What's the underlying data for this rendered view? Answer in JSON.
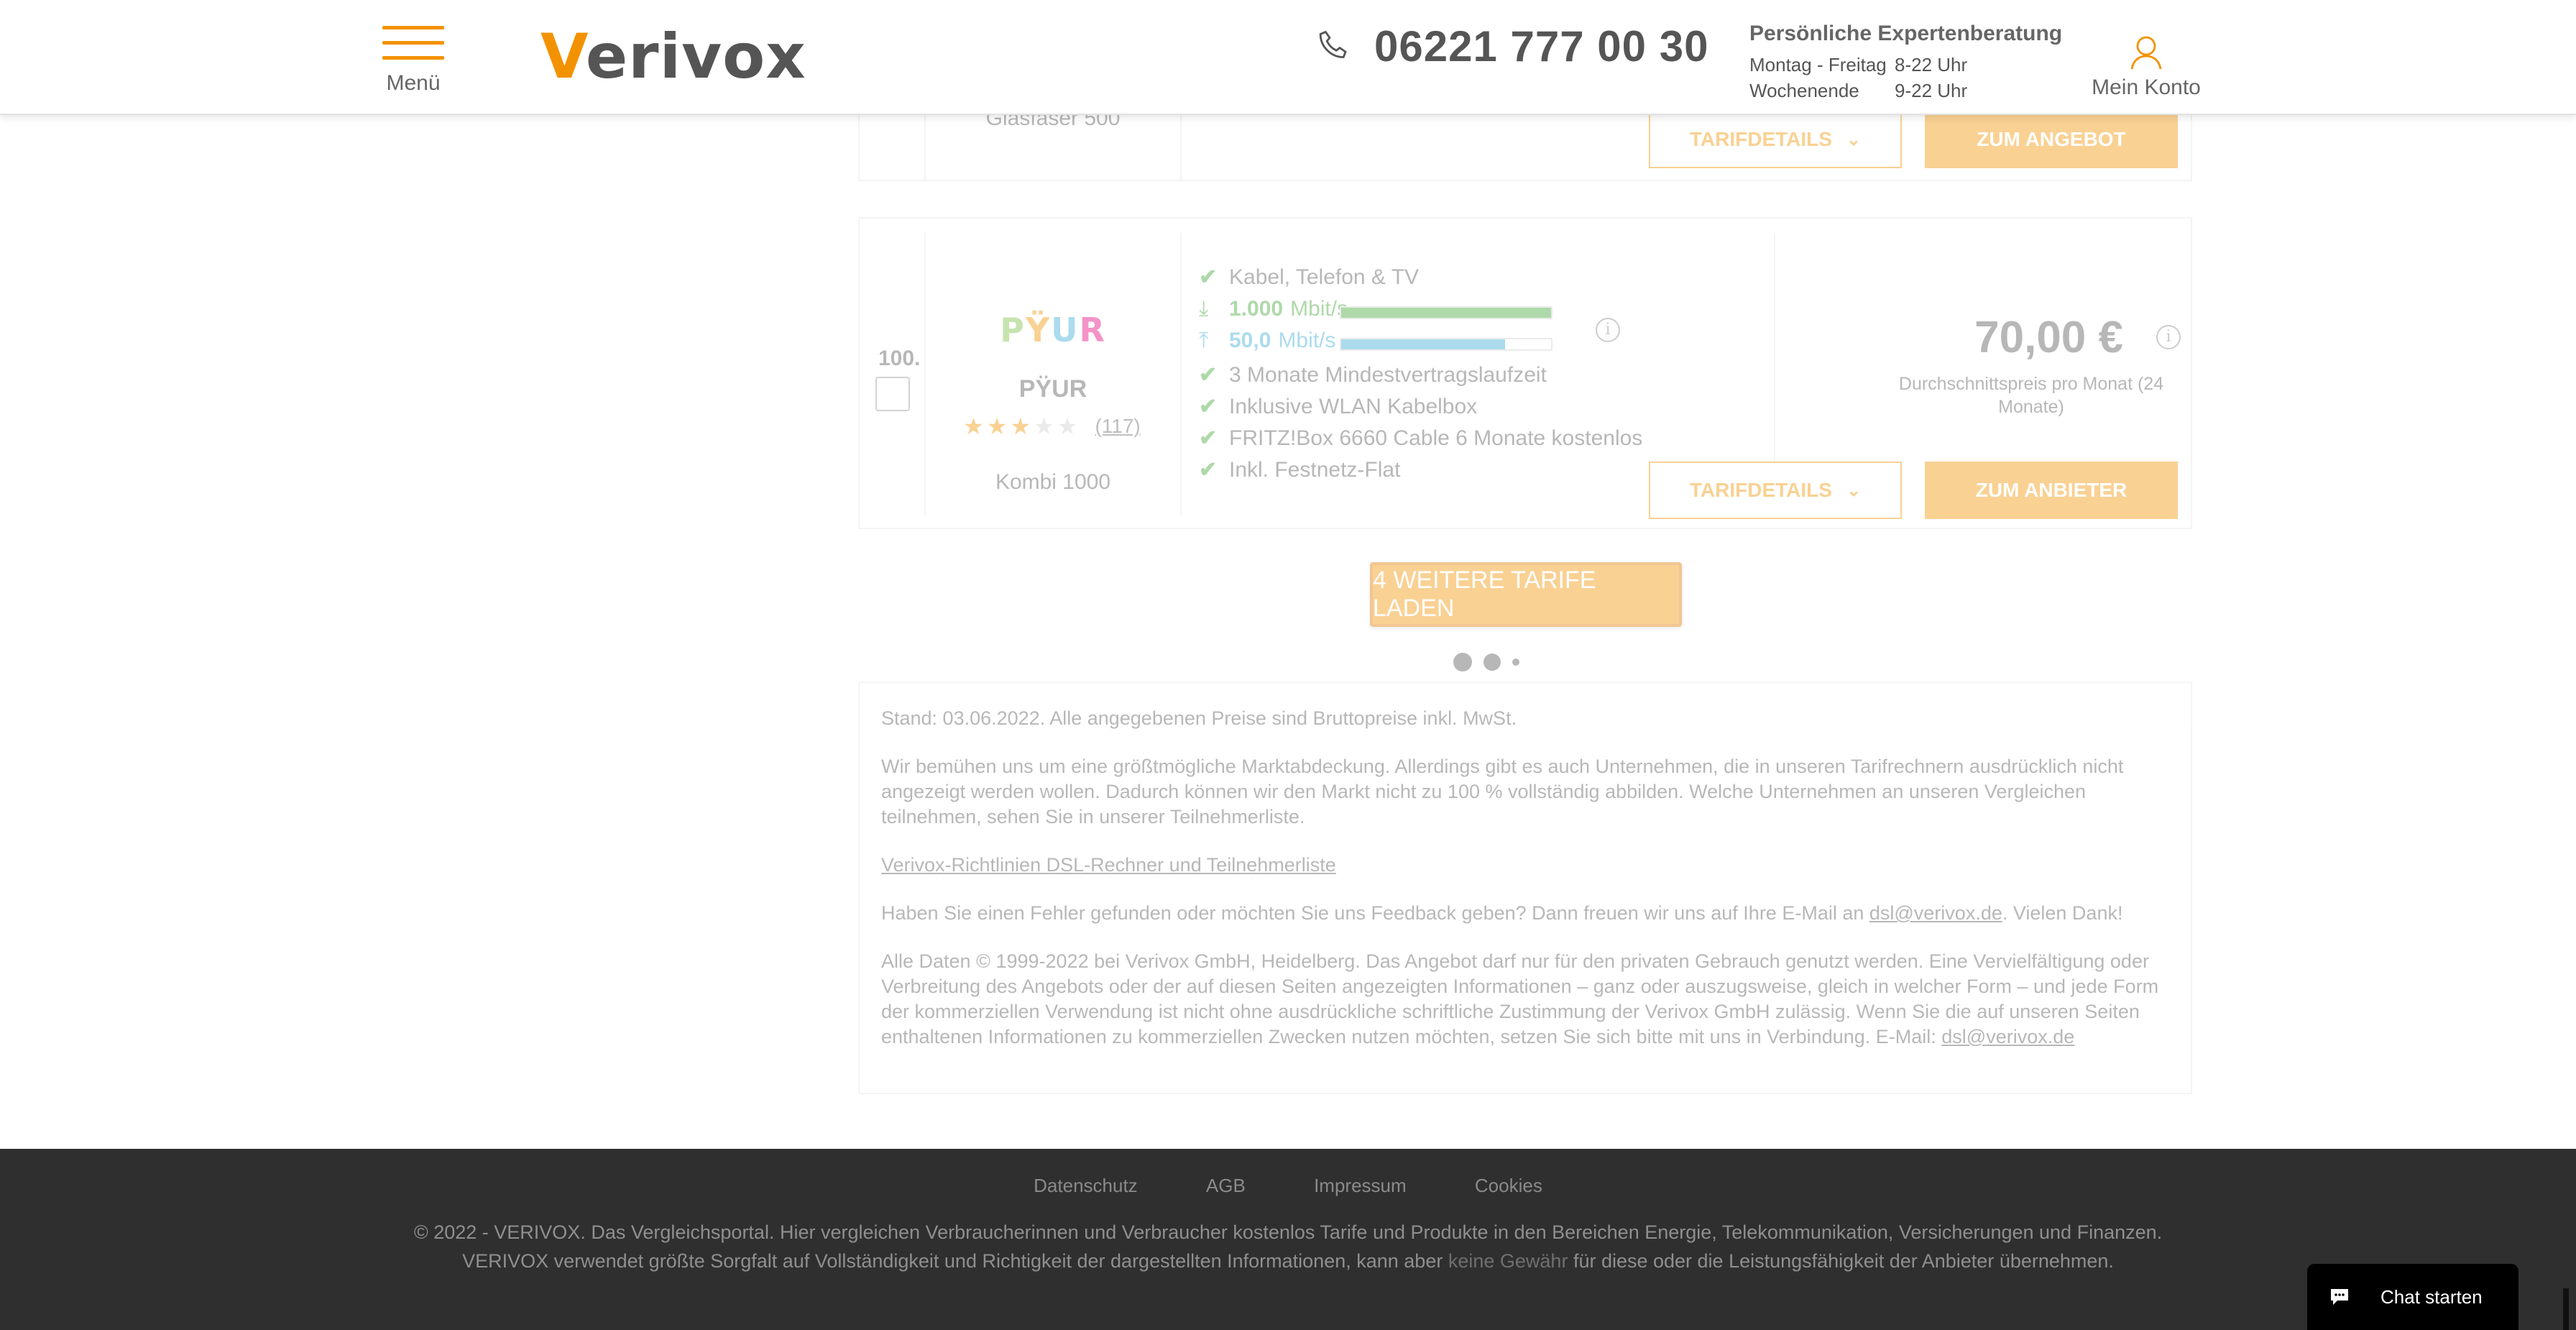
{
  "header": {
    "menu_label": "Menü",
    "logo_text": "erivox",
    "logo_letter": "V",
    "phone": "06221 777 00 30",
    "consult_title": "Persönliche Expertenberatung",
    "hours": [
      {
        "days": "Montag - Freitag",
        "time": "8-22 Uhr"
      },
      {
        "days": "Wochenende",
        "time": "9-22 Uhr"
      }
    ],
    "account_label": "Mein Konto"
  },
  "previous_card": {
    "tariff_name": "Glasfaser 500",
    "details_label": "TARIFDETAILS",
    "offer_label": "ZUM ANGEBOT"
  },
  "tariff": {
    "rank": "100.",
    "provider_logo": "PŸUR",
    "provider_name": "PŸUR",
    "rating_count": "(117)",
    "stars_filled": 3,
    "stars_total": 5,
    "tariff_name": "Kombi 1000",
    "features_top": [
      "Kabel, Telefon & TV"
    ],
    "download": {
      "value": "1.000",
      "unit": "Mbit/s",
      "fill_fraction": 1.0,
      "color": "#3fa535"
    },
    "upload": {
      "value": "50,0",
      "unit": "Mbit/s",
      "fill_fraction": 0.78,
      "color": "#3aaad6"
    },
    "features": [
      "3 Monate Mindestvertragslaufzeit",
      "Inklusive WLAN Kabelbox",
      "FRITZ!Box 6660 Cable 6 Monate kostenlos",
      "Inkl. Festnetz-Flat"
    ],
    "price": "70,00 €",
    "price_note": "Durchschnittspreis pro Monat (24 Monate)",
    "details_label": "TARIFDETAILS",
    "offer_label": "ZUM ANBIETER"
  },
  "load_more_label": "4 WEITERE TARIFE LADEN",
  "notes": {
    "stand": "Stand: 03.06.2022. Alle angegebenen Preise sind Bruttopreise inkl. MwSt.",
    "coverage": "Wir bemühen uns um eine größtmögliche Marktabdeckung. Allerdings gibt es auch Unternehmen, die in unseren Tarifrechnern ausdrücklich nicht angezeigt werden wollen. Dadurch können wir den Markt nicht zu 100 % vollständig abbilden. Welche Unternehmen an unseren Vergleichen teilnehmen, sehen Sie in unserer Teilnehmerliste.",
    "guidelines_link": "Verivox-Richtlinien DSL-Rechner und Teilnehmerliste",
    "feedback_pre": "Haben Sie einen Fehler gefunden oder möchten Sie uns Feedback geben? Dann freuen wir uns auf Ihre E-Mail an ",
    "feedback_email": "dsl@verivox.de",
    "feedback_post": ". Vielen Dank!",
    "copyright": "Alle Daten © 1999-2022 bei Verivox GmbH, Heidelberg. Das Angebot darf nur für den privaten Gebrauch genutzt werden. Eine Vervielfältigung oder Verbreitung des Angebots oder der auf diesen Seiten angezeigten Informationen – ganz oder auszugsweise, gleich in welcher Form – und jede Form der kommerziellen Verwendung ist nicht ohne ausdrückliche schriftliche Zustimmung der Verivox GmbH zulässig. Wenn Sie die auf unseren Seiten enthaltenen Informationen zu kommerziellen Zwecken nutzen möchten, setzen Sie sich bitte mit uns in Verbindung. E-Mail: ",
    "copyright_email": "dsl@verivox.de"
  },
  "footer": {
    "links": [
      "Datenschutz",
      "AGB",
      "Impressum",
      "Cookies"
    ],
    "text_pre": "© 2022 - VERIVOX. Das Vergleichsportal. Hier vergleichen Verbraucherinnen und Verbraucher kostenlos Tarife und Produkte in den Bereichen Energie, Telekommunikation, Versicherungen und Finanzen. VERIVOX verwendet größte Sorgfalt auf Vollständigkeit und Richtigkeit der dargestellten Informationen, kann aber ",
    "text_link": "keine Gewähr",
    "text_post": " für diese oder die Leistungsfähigkeit der Anbieter übernehmen."
  },
  "chat_label": "Chat starten",
  "colors": {
    "accent": "#f39200",
    "footer_bg": "#2f2f2f",
    "check": "#3fa535"
  },
  "icons": [
    "hamburger-icon",
    "phone-icon",
    "user-icon",
    "check-icon",
    "download-icon",
    "upload-icon",
    "info-icon",
    "chevron-down-icon",
    "chat-icon"
  ]
}
